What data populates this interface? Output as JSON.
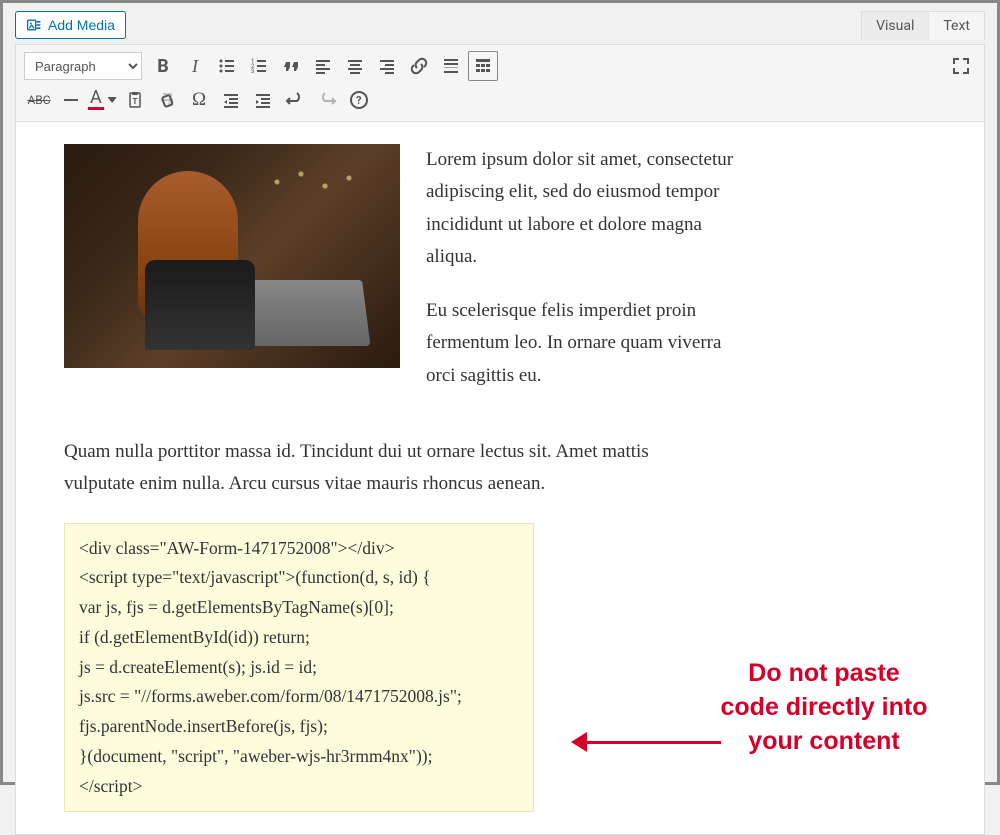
{
  "topbar": {
    "add_media_label": "Add Media",
    "tabs": {
      "visual": "Visual",
      "text": "Text"
    }
  },
  "toolbar": {
    "format_select": "Paragraph"
  },
  "content": {
    "para1": "Lorem ipsum dolor sit amet, consectetur adipiscing elit, sed do eiusmod tempor incididunt ut labore et dolore magna aliqua.",
    "para2": "Eu scelerisque felis imperdiet proin fermentum leo. In ornare quam viverra orci sagittis eu.",
    "para3": "Quam nulla porttitor massa id. Tincidunt dui ut ornare lectus sit. Amet mattis vulputate enim nulla. Arcu cursus vitae mauris rhoncus aenean.",
    "code": {
      "l1": "<div class=\"AW-Form-1471752008\"></div>",
      "l2": "<script type=\"text/javascript\">(function(d, s, id) {",
      "l3": "var js, fjs = d.getElementsByTagName(s)[0];",
      "l4": "if (d.getElementById(id)) return;",
      "l5": "js = d.createElement(s); js.id = id;",
      "l6": "js.src = \"//forms.aweber.com/form/08/1471752008.js\";",
      "l7": "fjs.parentNode.insertBefore(js, fjs);",
      "l8": "}(document, \"script\", \"aweber-wjs-hr3rmm4nx\"));",
      "l9": "</script>"
    }
  },
  "annotation": {
    "line1": "Do not paste",
    "line2": "code directly into",
    "line3": "your content"
  }
}
